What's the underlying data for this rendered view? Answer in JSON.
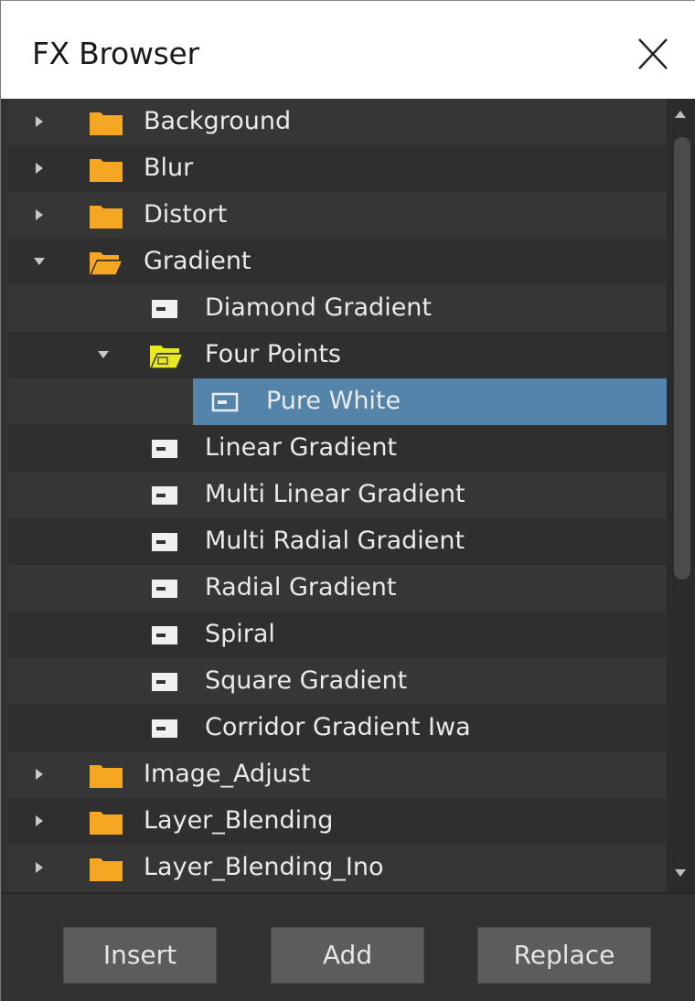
{
  "window": {
    "title": "FX Browser"
  },
  "tree": {
    "items": [
      {
        "label": "Background",
        "type": "folder",
        "expanded": false
      },
      {
        "label": "Blur",
        "type": "folder",
        "expanded": false
      },
      {
        "label": "Distort",
        "type": "folder",
        "expanded": false
      },
      {
        "label": "Gradient",
        "type": "folder",
        "expanded": true
      },
      {
        "label": "Diamond Gradient",
        "type": "fx"
      },
      {
        "label": "Four Points",
        "type": "preset-folder",
        "expanded": true
      },
      {
        "label": "Pure White",
        "type": "preset",
        "selected": true
      },
      {
        "label": "Linear Gradient",
        "type": "fx"
      },
      {
        "label": "Multi Linear Gradient",
        "type": "fx"
      },
      {
        "label": "Multi Radial Gradient",
        "type": "fx"
      },
      {
        "label": "Radial Gradient",
        "type": "fx"
      },
      {
        "label": "Spiral",
        "type": "fx"
      },
      {
        "label": "Square Gradient",
        "type": "fx"
      },
      {
        "label": "Corridor Gradient Iwa",
        "type": "fx"
      },
      {
        "label": "Image_Adjust",
        "type": "folder",
        "expanded": false
      },
      {
        "label": "Layer_Blending",
        "type": "folder",
        "expanded": false
      },
      {
        "label": "Layer_Blending_Ino",
        "type": "folder",
        "expanded": false
      }
    ]
  },
  "buttons": {
    "insert": "Insert",
    "add": "Add",
    "replace": "Replace"
  },
  "colors": {
    "folder": "#f5a623",
    "preset_folder": "#e8e820",
    "selection": "#5584ab",
    "panel": "#323232"
  }
}
